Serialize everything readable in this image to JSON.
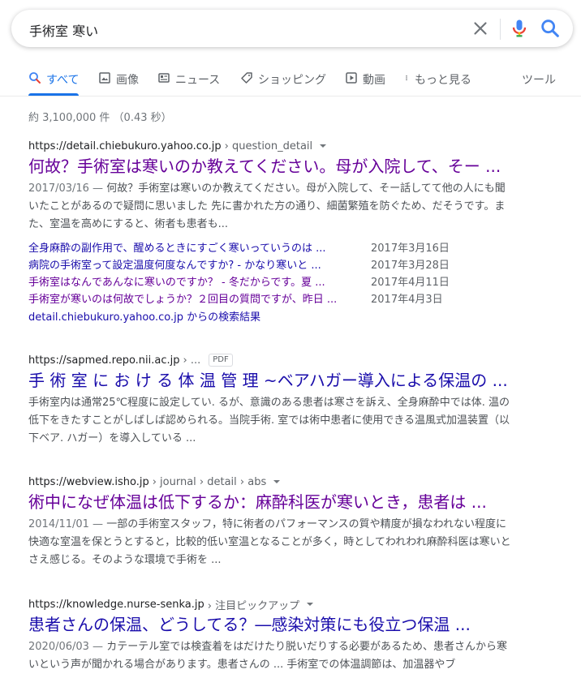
{
  "search": {
    "query": "手術室 寒い"
  },
  "tabs": [
    {
      "label": "すべて",
      "icon": "search-icon",
      "active": true
    },
    {
      "label": "画像",
      "icon": "image-icon"
    },
    {
      "label": "ニュース",
      "icon": "news-icon"
    },
    {
      "label": "ショッピング",
      "icon": "tag-icon"
    },
    {
      "label": "動画",
      "icon": "play-icon"
    },
    {
      "label": "もっと見る",
      "icon": "more-vert-icon"
    },
    {
      "label": "ツール"
    }
  ],
  "stats": "約 3,100,000 件 （0.43 秒）",
  "results": [
    {
      "domain": "https://detail.chiebukuro.yahoo.co.jp",
      "path": "› question_detail",
      "title": "何故？手術室は寒いのか教えてください。母が入院して、そー ...",
      "date": "2017/03/16 —",
      "snippet": "何故？手術室は寒いのか教えてください。母が入院して、そー話してて他の人にも聞いたことがあるので疑問に思いました 先に書かれた方の通り、細菌繁殖を防ぐため、だそうです。また、室温を高めにすると、術者も患者も...",
      "sitelinks": [
        {
          "text": "全身麻酔の副作用で、醒めるときにすごく寒いっていうのは ...",
          "date": "2017年3月16日"
        },
        {
          "text": "病院の手術室って設定温度何度なんですか? - かなり寒いと ...",
          "date": "2017年3月28日"
        },
        {
          "text": "手術室はなんであんなに寒いのですか？ - 冬だからです。夏 ...",
          "date": "2017年4月11日"
        },
        {
          "text": "手術室が寒いのは何故でしょうか？２回目の質問ですが、昨日 ...",
          "date": "2017年4月3日"
        }
      ],
      "more_from": "detail.chiebukuro.yahoo.co.jp からの検索結果"
    },
    {
      "domain": "https://sapmed.repo.nii.ac.jp",
      "path": "› ...",
      "badge": "PDF",
      "title": "手 術 室 に お け る 体 温 管 理 ~ベアハガー導入による保温の ...",
      "snippet": "手術室内は通常25℃程度に設定してい. るが、意識のある患者は寒さを訴え、全身麻酔中では体. 温の低下をきたすことがしばしば認められる。当院手術. 室では術中患者に使用できる温風式加温装置（以下ベア. ハガー）を導入している ..."
    },
    {
      "domain": "https://webview.isho.jp",
      "path": "› journal › detail › abs",
      "title": "術中になぜ体温は低下するか：麻酔科医が寒いとき，患者は ...",
      "date": "2014/11/01 —",
      "snippet": "一部の手術室スタッフ，特に術者のパフォーマンスの質や精度が損なわれない程度に快適な室温を保とうとすると，比較的低い室温となることが多く，時としてわれわれ麻酔科医は寒いとさえ感じる。そのような環境で手術を ..."
    },
    {
      "domain": "https://knowledge.nurse-senka.jp",
      "path": "› 注目ピックアップ",
      "title": "患者さんの保温、どうしてる？―感染対策にも役立つ保温 ...",
      "date": "2020/06/03 —",
      "snippet": "カテーテル室では検査着をはだけたり脱いだりする必要があるため、患者さんから寒いという声が聞かれる場合があります。患者さんの ... 手術室での体温調節は、加温器やブ"
    }
  ],
  "colors": {
    "link": "#1a0dab",
    "visited": "#660099",
    "accent": "#1a73e8"
  }
}
